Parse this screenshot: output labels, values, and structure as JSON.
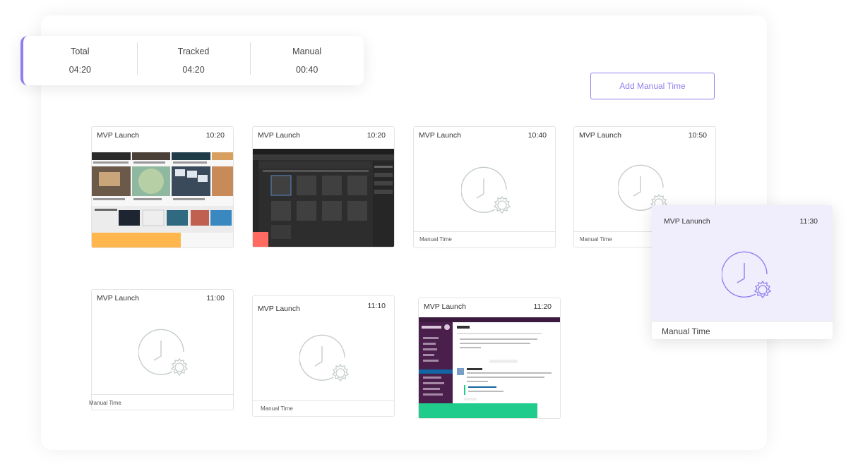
{
  "stats": [
    {
      "label": "Total",
      "value": "04:20"
    },
    {
      "label": "Tracked",
      "value": "04:20"
    },
    {
      "label": "Manual",
      "value": "00:40"
    }
  ],
  "add_button": "Add Manual Time",
  "cards": [
    {
      "title": "MVP Launch",
      "time": "10:20",
      "kind": "screenshot",
      "bar_color": "#ffb74d"
    },
    {
      "title": "MVP Launch",
      "time": "10:20",
      "kind": "screenshot",
      "bar_color": "#ff6b61"
    },
    {
      "title": "MVP Launch",
      "time": "10:40",
      "kind": "manual",
      "footer": "Manual Time"
    },
    {
      "title": "MVP Launch",
      "time": "10:50",
      "kind": "manual",
      "footer": "Manual Time"
    },
    {
      "title": "MVP Launch",
      "time": "11:00",
      "kind": "manual",
      "footer": "Manual Time"
    },
    {
      "title": "MVP Launch",
      "time": "11:10",
      "kind": "manual",
      "footer": "Manual Time"
    },
    {
      "title": "MVP Launch",
      "time": "11:20",
      "kind": "screenshot",
      "bar_color": "#1fcc8c"
    }
  ],
  "floating_card": {
    "title": "MVP Lanunch",
    "time": "11:30",
    "footer": "Manual Time"
  },
  "colors": {
    "accent": "#8e7ff0",
    "clock_gray": "#c4cccb"
  },
  "icons": [
    "clock-gear-icon"
  ]
}
